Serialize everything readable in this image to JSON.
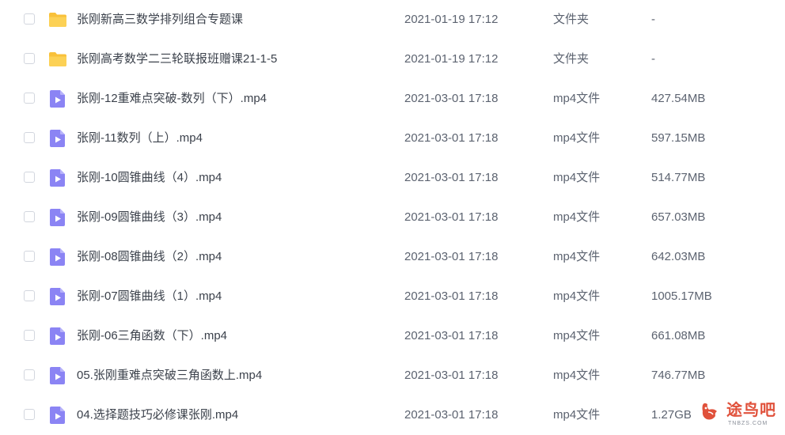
{
  "colors": {
    "folder": "#f9c13a",
    "video": "#8b84f4",
    "watermark": "#e0513b"
  },
  "files": [
    {
      "name": "张刚新高三数学排列组合专题课",
      "date": "2021-01-19 17:12",
      "type": "文件夹",
      "size": "-",
      "icon": "folder-icon"
    },
    {
      "name": "张刚高考数学二三轮联报班赠课21-1-5",
      "date": "2021-01-19 17:12",
      "type": "文件夹",
      "size": "-",
      "icon": "folder-icon"
    },
    {
      "name": "张刚-12重难点突破-数列（下）.mp4",
      "date": "2021-03-01 17:18",
      "type": "mp4文件",
      "size": "427.54MB",
      "icon": "video-file-icon"
    },
    {
      "name": "张刚-11数列（上）.mp4",
      "date": "2021-03-01 17:18",
      "type": "mp4文件",
      "size": "597.15MB",
      "icon": "video-file-icon"
    },
    {
      "name": "张刚-10圆锥曲线（4）.mp4",
      "date": "2021-03-01 17:18",
      "type": "mp4文件",
      "size": "514.77MB",
      "icon": "video-file-icon"
    },
    {
      "name": "张刚-09圆锥曲线（3）.mp4",
      "date": "2021-03-01 17:18",
      "type": "mp4文件",
      "size": "657.03MB",
      "icon": "video-file-icon"
    },
    {
      "name": "张刚-08圆锥曲线（2）.mp4",
      "date": "2021-03-01 17:18",
      "type": "mp4文件",
      "size": "642.03MB",
      "icon": "video-file-icon"
    },
    {
      "name": "张刚-07圆锥曲线（1）.mp4",
      "date": "2021-03-01 17:18",
      "type": "mp4文件",
      "size": "1005.17MB",
      "icon": "video-file-icon"
    },
    {
      "name": "张刚-06三角函数（下）.mp4",
      "date": "2021-03-01 17:18",
      "type": "mp4文件",
      "size": "661.08MB",
      "icon": "video-file-icon"
    },
    {
      "name": "05.张刚重难点突破三角函数上.mp4",
      "date": "2021-03-01 17:18",
      "type": "mp4文件",
      "size": "746.77MB",
      "icon": "video-file-icon"
    },
    {
      "name": "04.选择题技巧必修课张刚.mp4",
      "date": "2021-03-01 17:18",
      "type": "mp4文件",
      "size": "1.27GB",
      "icon": "video-file-icon"
    }
  ],
  "watermark": {
    "text": "途鸟吧",
    "subtext": "TNBZS.COM"
  }
}
